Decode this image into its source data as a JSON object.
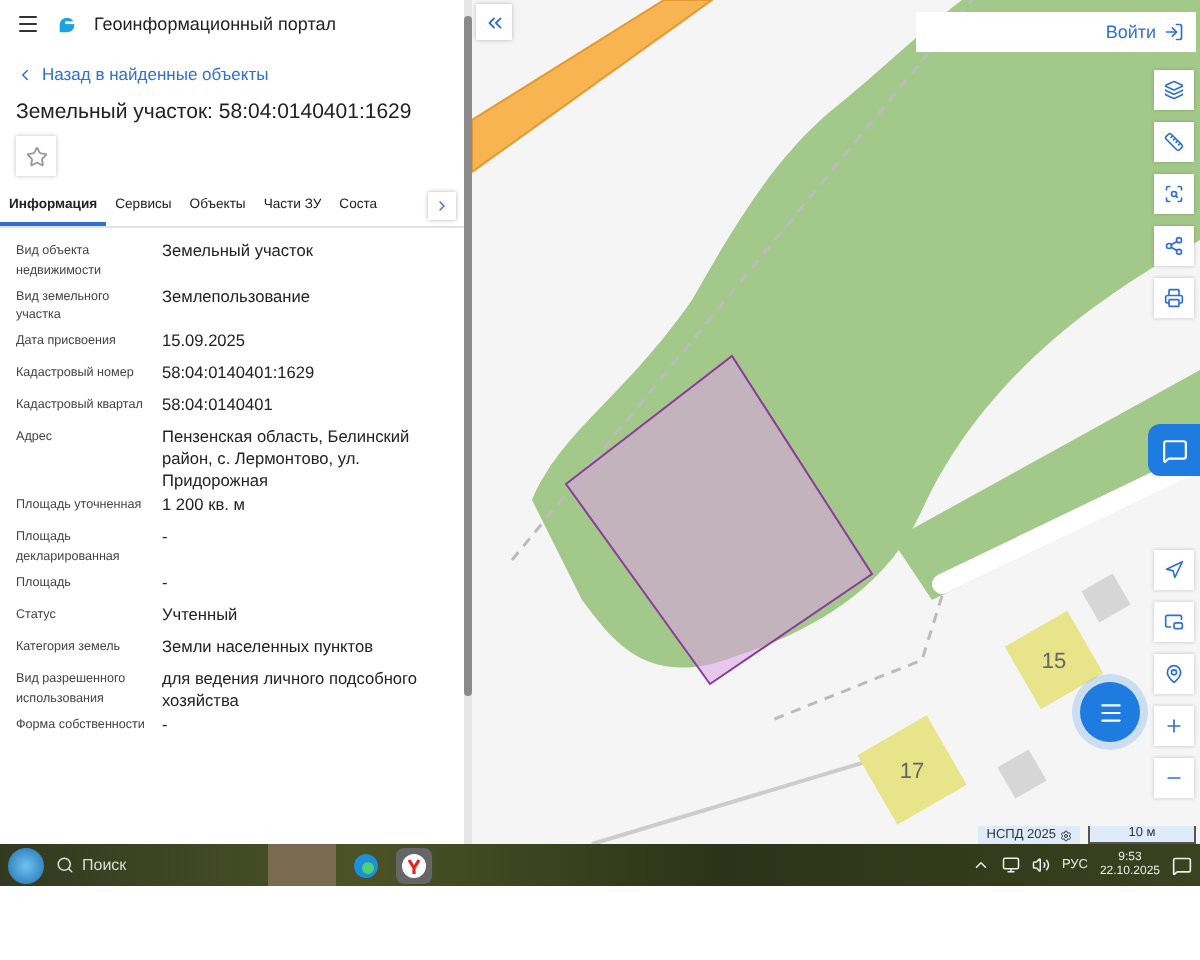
{
  "header": {
    "title": "Геоинформационный портал"
  },
  "back_link": "Назад в найденные объекты",
  "object_title": "Земельный участок: 58:04:0140401:1629",
  "favorite": {
    "on": false
  },
  "tabs": [
    {
      "label": "Информация",
      "selected": true
    },
    {
      "label": "Сервисы",
      "selected": false
    },
    {
      "label": "Объекты",
      "selected": false
    },
    {
      "label": "Части ЗУ",
      "selected": false
    },
    {
      "label": "Соста",
      "selected": false
    }
  ],
  "properties": [
    {
      "label": "Вид объекта недвижимости",
      "value": "Земельный участок"
    },
    {
      "label": "Вид земельного участка",
      "value": "Землепользование"
    },
    {
      "label": "Дата присвоения",
      "value": "15.09.2025"
    },
    {
      "label": "Кадастровый номер",
      "value": "58:04:0140401:1629"
    },
    {
      "label": "Кадастровый квартал",
      "value": "58:04:0140401"
    },
    {
      "label": "Адрес",
      "value": "Пензенская область, Белинский район, с. Лермонтово, ул. Придорожная"
    },
    {
      "label": "Площадь уточненная",
      "value": "1 200 кв. м"
    },
    {
      "label": "Площадь декларированная",
      "value": "-"
    },
    {
      "label": "Площадь",
      "value": "-"
    },
    {
      "label": "Статус",
      "value": "Учтенный"
    },
    {
      "label": "Категория земель",
      "value": "Земли населенных пунктов"
    },
    {
      "label": "Вид разрешенного использования",
      "value": "для ведения личного подсобного хозяйства"
    },
    {
      "label": "Форма собственности",
      "value": "-"
    }
  ],
  "map": {
    "login": "Войти",
    "buildings": [
      "15",
      "17"
    ],
    "attribution": "НСПД 2025",
    "scale": "10 м"
  },
  "taskbar": {
    "search": "Поиск",
    "language": "РУС",
    "time": "9:53",
    "date": "22.10.2025"
  }
}
